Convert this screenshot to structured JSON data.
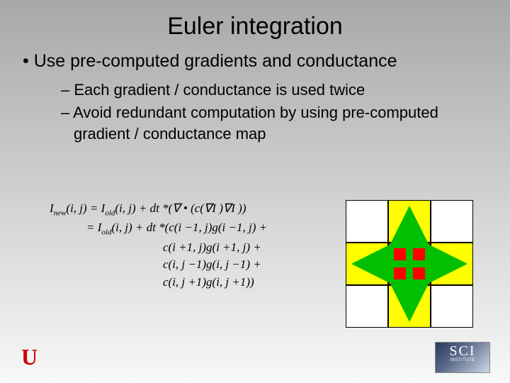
{
  "title": "Euler integration",
  "bullet_main": "Use pre-computed gradients and conductance",
  "sub_bullets": [
    "Each gradient / conductance is used twice",
    "Avoid redundant computation by using pre-computed gradient / conductance map"
  ],
  "formula": {
    "line1_lhs": "I",
    "line1_sub1": "new",
    "line1_mid": "(i, j) = I",
    "line1_sub2": "old",
    "line1_rhs": "(i, j) + dt *(∇ • (c(∇I )∇I ))",
    "line2_lhs": "= I",
    "line2_sub": "old",
    "line2_rhs": "(i, j) + dt *(c(i −1, j)g(i −1, j) +",
    "line3": "c(i +1, j)g(i +1, j) +",
    "line4": "c(i, j −1)g(i, j −1) +",
    "line5": "c(i, j +1)g(i, j +1))"
  },
  "grid_colors": [
    "white",
    "yellow",
    "white",
    "yellow",
    "red",
    "yellow",
    "white",
    "yellow",
    "white"
  ],
  "logo_u": "U",
  "logo_sci_big": "SCI",
  "logo_sci_small": "INSTITUTE"
}
